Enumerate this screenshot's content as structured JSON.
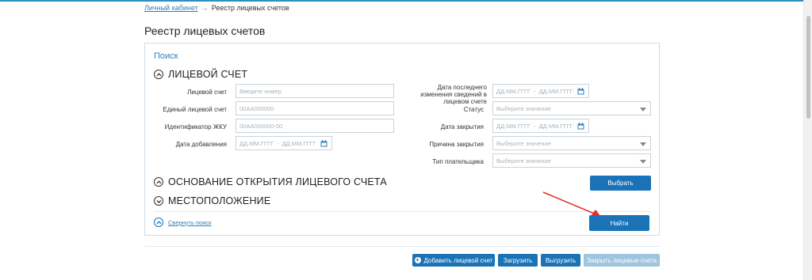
{
  "breadcrumb": {
    "home": "Личный кабинет",
    "separator": "→",
    "current": "Реестр лицевых счетов"
  },
  "page": {
    "title": "Реестр лицевых счетов"
  },
  "search": {
    "caption": "Поиск",
    "section_account": "ЛИЦЕВОЙ СЧЕТ",
    "section_basis": "ОСНОВАНИЕ ОТКРЫТИЯ ЛИЦЕВОГО СЧЕТА",
    "section_location": "МЕСТОПОЛОЖЕНИЕ",
    "collapse_label": "Свернуть поиск",
    "find_button": "Найти",
    "choose_button": "Выбрать"
  },
  "fields_left": {
    "account_label": "Лицевой счет",
    "account_placeholder": "Введите номер",
    "unified_label": "Единый лицевой счет",
    "unified_placeholder": "00АА000000",
    "jku_label": "Идентификатор ЖКУ",
    "jku_placeholder": "00АА000000-00",
    "added_label": "Дата добавления",
    "added_from": "ДД.ММ.ГГГГ",
    "added_dash": "-",
    "added_to": "ДД.ММ.ГГГГ"
  },
  "fields_right": {
    "changed_label": "Дата последнего изменения сведений в лицевом счете",
    "changed_from": "ДД.ММ.ГГГГ",
    "changed_dash": "-",
    "changed_to": "ДД.ММ.ГГГГ",
    "status_label": "Статус",
    "status_value": "Выберите значение",
    "closing_label": "Дата закрытия",
    "closing_from": "ДД.ММ.ГГГГ",
    "closing_dash": "-",
    "closing_to": "ДД.ММ.ГГГГ",
    "reason_label": "Причина закрытия",
    "reason_value": "Выберите значение",
    "payer_label": "Тип плательщика",
    "payer_value": "Выберите значение"
  },
  "actions": {
    "add": "Добавить лицевой счет",
    "upload": "Загрузить",
    "download": "Выгрузить",
    "close_accounts": "Закрыть лицевые счета"
  },
  "colors": {
    "accent": "#1a73b6",
    "link": "#2f7fb8",
    "annotation": "#e0302b"
  }
}
